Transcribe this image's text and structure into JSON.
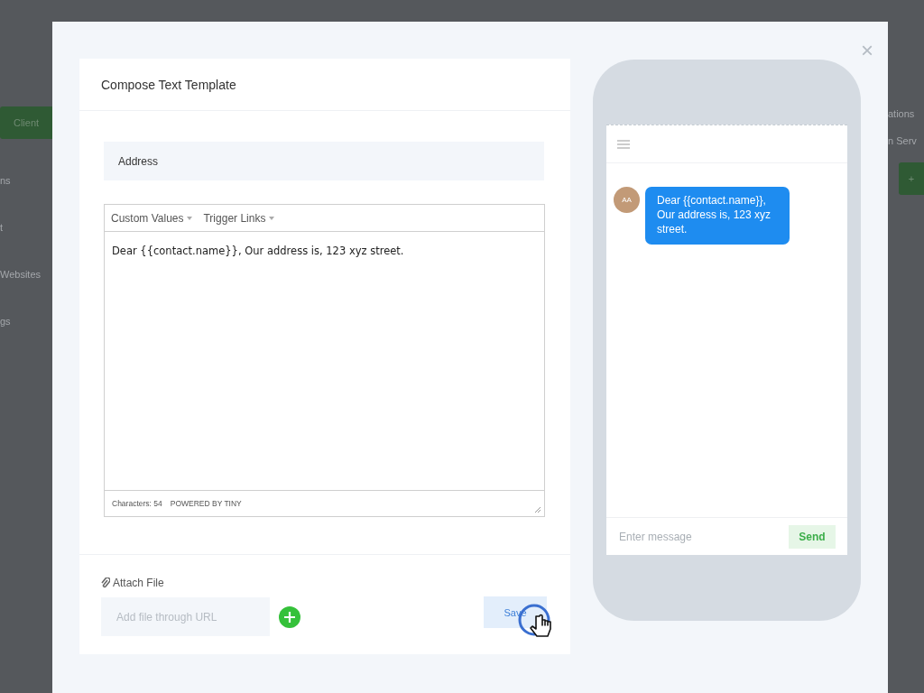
{
  "background": {
    "left_items": [
      {
        "label": "Client",
        "kind": "button"
      },
      {
        "label": "ns",
        "kind": "text"
      },
      {
        "label": "t",
        "kind": "text"
      },
      {
        "label": "Websites",
        "kind": "text"
      },
      {
        "label": "gs",
        "kind": "text"
      }
    ],
    "right_items": [
      {
        "label": "ations",
        "kind": "text"
      },
      {
        "label": "n Serv",
        "kind": "text"
      },
      {
        "label": "+",
        "kind": "button"
      }
    ]
  },
  "modal": {
    "close": "×",
    "composer": {
      "title": "Compose Text Template",
      "name_field": {
        "value": "Address"
      },
      "editor": {
        "menus": [
          "Custom Values",
          "Trigger Links"
        ],
        "body": "Dear {{contact.name}}, Our address is, 123 xyz street.",
        "character_count": "Characters: 54",
        "branding": "POWERED BY TINY"
      },
      "attach": {
        "label": "Attach File",
        "placeholder": "Add file through URL"
      },
      "save_button": "Save"
    },
    "preview": {
      "avatar": "AA",
      "message": "Dear {{contact.name}}, Our address is, 123 xyz street.",
      "input": {
        "placeholder": "Enter message"
      },
      "send_button": "Send"
    }
  }
}
